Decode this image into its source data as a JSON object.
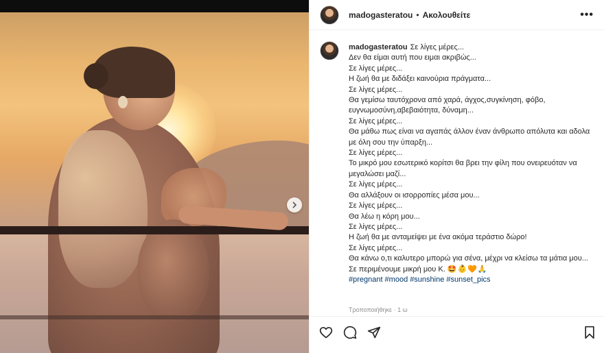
{
  "post": {
    "username": "madogasteratou",
    "dot": "•",
    "follow_label": "Ακολουθείτε",
    "more_label": "•••"
  },
  "caption": {
    "username": "madogasteratou",
    "lines": [
      "Σε λίγες μέρες...",
      "Δεν θα είμαι αυτή που ειμαι ακριβώς...",
      "Σε λίγες μέρες...",
      "Η ζωή θα με διδάξει καινούρια πράγματα...",
      "Σε λίγες μέρες...",
      "Θα γεμίσω ταυτόχρονα από χαρά, άγχος,συγκίνηση, φόβο, ευγνωμοσύνη,αβεβαιότητα, δύναμη...",
      "Σε λίγες μέρες...",
      "Θα μάθω πως είναι να αγαπάς άλλον έναν άνθρωπο απόλυτα και αδολα με όλη σου την ύπαρξη...",
      "Σε λίγες μέρες...",
      "Το μικρό μου εσωτερικό κορίτσι θα βρει την φίλη που ονειρευόταν να μεγαλώσει μαζί...",
      "Σε λίγες μέρες...",
      "Θα αλλάξουν οι ισορροπίες μέσα μου...",
      "Σε λίγες μέρες...",
      "Θα λέω η κόρη μου...",
      "Σε λίγες μέρες...",
      "Η ζωή θα με ανταμείψει με ένα ακόμα τεράστιο δώρο!",
      "Σε λίγες μέρες...",
      "Θα κάνω ο,τι καλυτερο μπορώ για σένα, μέχρι να κλείσω τα μάτια μου...",
      "Σε περιμένουμε μικρή μου Κ."
    ],
    "emoji": "🤩👶🧡🙏",
    "hashtags": [
      "#pregnant",
      "#mood",
      "#sunshine",
      "#sunset_pics"
    ]
  },
  "meta": {
    "edited": "Τροποποιήθηκε · 1 ω"
  },
  "actions": {
    "like": "heart-icon",
    "comment": "comment-icon",
    "share": "send-icon",
    "save": "bookmark-icon"
  }
}
